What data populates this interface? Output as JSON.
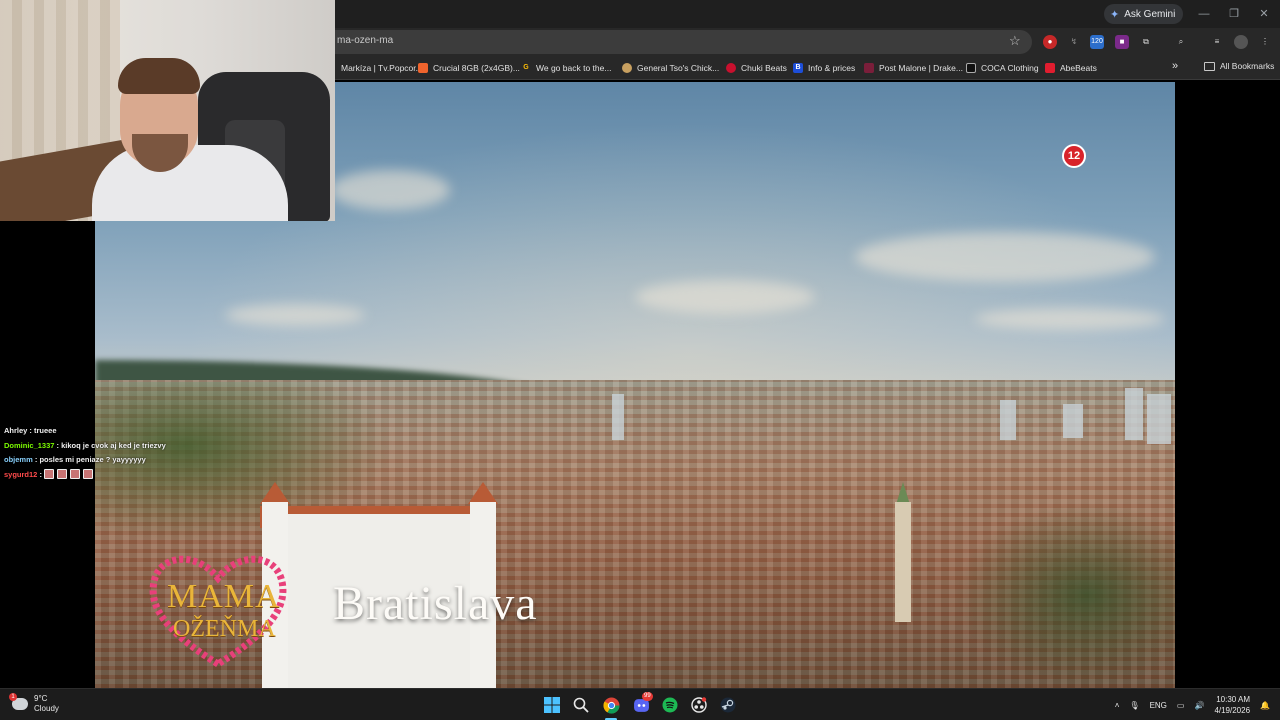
{
  "browser": {
    "ask_gemini": "Ask Gemini",
    "url_fragment": "ma-ozen-ma",
    "bookmarks": [
      {
        "label": "Markíza | Tv.Popcor...",
        "color": "#d22"
      },
      {
        "label": "Crucial 8GB (2x4GB)...",
        "color": "#f0642d"
      },
      {
        "label": "We go back to the...",
        "color": "#4285f4"
      },
      {
        "label": "General Tso's Chick...",
        "color": "#c8a060"
      },
      {
        "label": "Chuki Beats",
        "color": "#c8102e"
      },
      {
        "label": "Info & prices",
        "color": "#1d4ed8"
      },
      {
        "label": "Post Malone | Drake...",
        "color": "#7a1e3a"
      },
      {
        "label": "COCA Clothing",
        "color": "#111"
      },
      {
        "label": "AbeBeats",
        "color": "#e11d2f"
      }
    ],
    "all_bookmarks": "All Bookmarks",
    "extension_badge": "120"
  },
  "video": {
    "title": "Bratislava",
    "rating": "12",
    "logo_line1": "MAMA",
    "logo_line2": "OŽEŇMA"
  },
  "chat": [
    {
      "user": "Ahrley",
      "user_color": "#f3f3f3",
      "message": "trueee"
    },
    {
      "user": "Dominic_1337",
      "user_color": "#7cfc00",
      "message": "kikoq je cvok aj ked je triezvy"
    },
    {
      "user": "objemm",
      "user_color": "#87cefa",
      "message": "posles mi peniaze ? yayyyyyy"
    },
    {
      "user": "sygurd12",
      "user_color": "#ff4b4b",
      "message": "",
      "emotes": 4
    }
  ],
  "taskbar": {
    "weather_temp": "9°C",
    "weather_desc": "Cloudy",
    "weather_badge": "1",
    "lang": "ENG",
    "time": "10:30 AM",
    "date": "4/19/2026",
    "discord_badge": "99"
  }
}
